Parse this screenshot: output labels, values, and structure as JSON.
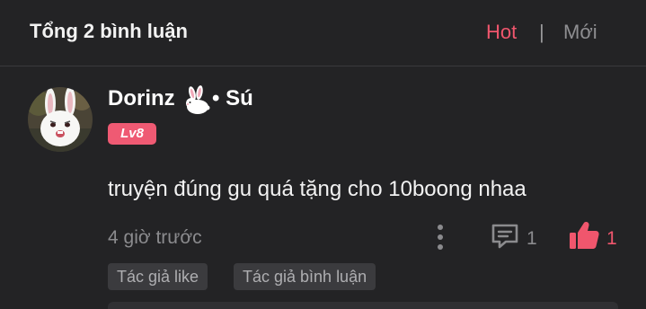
{
  "header": {
    "title": "Tổng 2 bình luận",
    "sort_hot": "Hot",
    "separator": "|",
    "sort_new": "Mới",
    "active_color": "#f0566d"
  },
  "comment": {
    "avatar_icon": "white-rabbit-avatar",
    "username": "Dorinz",
    "username_sticker": "rabbit-emoji",
    "username_suffix": "• Sú",
    "level": "Lv8",
    "level_color": "#ef5a73",
    "text": "truyện đúng gu quá tặng cho 10boong nhaa",
    "time": "4 giờ trước",
    "reply_count": "1",
    "like_count": "1",
    "like_color": "#f0566d",
    "tags": [
      "Tác giả like",
      "Tác giả bình luận"
    ]
  }
}
